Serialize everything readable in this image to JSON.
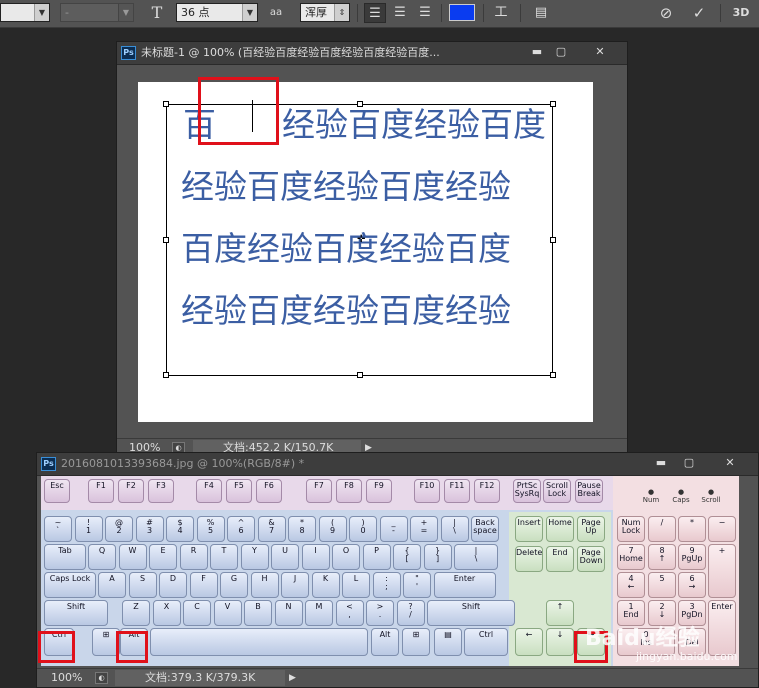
{
  "optionbar": {
    "font_size": "36 点",
    "aa_label": "aa",
    "aa_mode": "浑厚",
    "text_color": "#0a3cf0"
  },
  "doc1": {
    "title": "未标题-1 @ 100% (百经验百度经验百度经验百度经验百度...",
    "lines": [
      "百　　经验百度经验百度",
      "经验百度经验百度经验",
      "百度经验百度经验百度",
      "经验百度经验百度经验"
    ],
    "zoom": "100%",
    "doc_info": "文档:452.2 K/150.7K"
  },
  "doc2": {
    "title": "2016081013393684.jpg @ 100%(RGB/8#) *",
    "zoom": "100%",
    "doc_info": "文档:379.3 K/379.3K"
  },
  "keyboard": {
    "fkeys": [
      "Esc",
      "F1",
      "F2",
      "F3",
      "F4",
      "F5",
      "F6",
      "F7",
      "F8",
      "F9",
      "F10",
      "F11",
      "F12"
    ],
    "sys": [
      "PrtSc\nSysRq",
      "Scroll\nLock",
      "Pause\nBreak"
    ],
    "lights": [
      "Num",
      "Caps",
      "Scroll"
    ],
    "row1": [
      "~\n`",
      "!\n1",
      "@\n2",
      "#\n3",
      "$\n4",
      "%\n5",
      "^\n6",
      "&\n7",
      "*\n8",
      "(\n9",
      ")\n0",
      "_\n-",
      "+\n=",
      "|\n\\",
      "Back\nspace"
    ],
    "row2": [
      "Tab",
      "Q",
      "W",
      "E",
      "R",
      "T",
      "Y",
      "U",
      "I",
      "O",
      "P",
      "{\n[",
      "}\n]"
    ],
    "row3": [
      "Caps Lock",
      "A",
      "S",
      "D",
      "F",
      "G",
      "H",
      "J",
      "K",
      "L",
      ":\n;",
      "\"\n'",
      "Enter"
    ],
    "row4": [
      "Shift",
      "Z",
      "X",
      "C",
      "V",
      "B",
      "N",
      "M",
      "<\n,",
      ">\n.",
      "?\n/",
      "Shift"
    ],
    "row5": [
      "Ctrl",
      "⊞",
      "Alt",
      "",
      "Alt",
      "⊞",
      "▤",
      "Ctrl"
    ],
    "nav": [
      "Insert",
      "Home",
      "Page\nUp",
      "Delete",
      "End",
      "Page\nDown"
    ],
    "arrows": [
      "↑",
      "←",
      "↓",
      "→"
    ],
    "numpad": [
      "Num\nLock",
      "/",
      "*",
      "−",
      "7\nHome",
      "8\n↑",
      "9\nPgUp",
      "+",
      "4\n←",
      "5",
      "6\n→",
      "1\nEnd",
      "2\n↓",
      "3\nPgDn",
      "Enter",
      "0\nIns",
      ".\nDel"
    ]
  },
  "watermark": {
    "brand": "Baidu经验",
    "url": "jingyan.baidu.com"
  }
}
